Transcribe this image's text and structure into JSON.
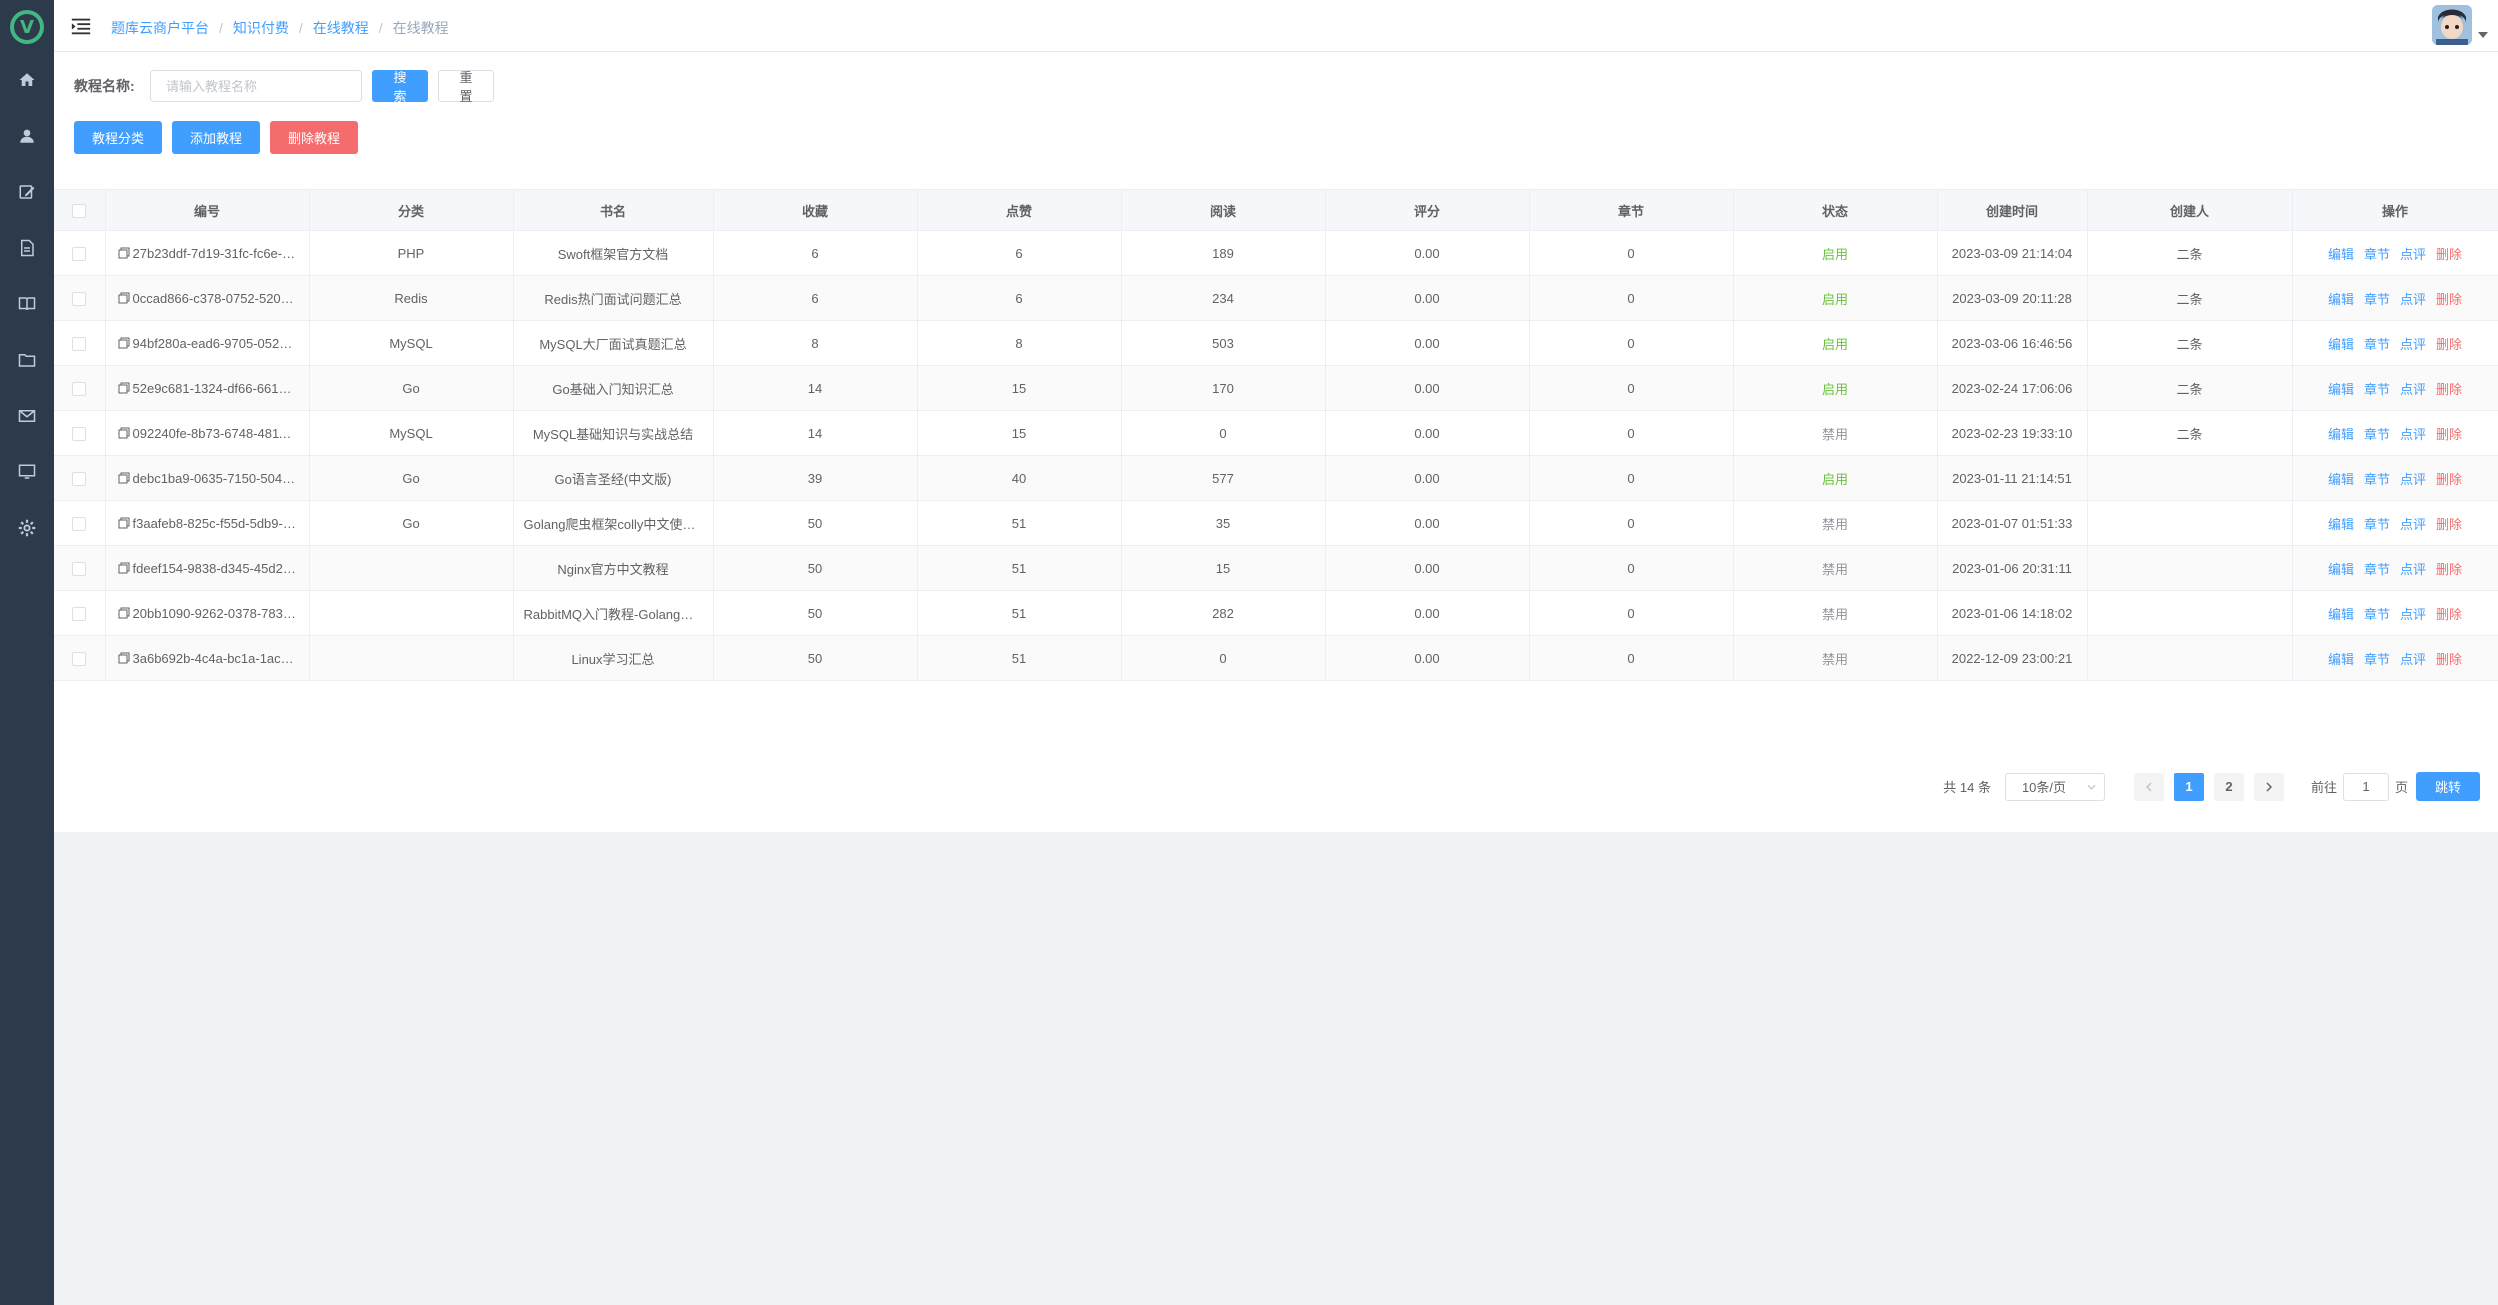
{
  "sidebar": {
    "logo_letter": "V",
    "items": [
      {
        "icon": "home-icon"
      },
      {
        "icon": "user-icon"
      },
      {
        "icon": "edit-icon"
      },
      {
        "icon": "document-icon"
      },
      {
        "icon": "book-icon"
      },
      {
        "icon": "folder-icon"
      },
      {
        "icon": "mail-icon"
      },
      {
        "icon": "monitor-icon"
      },
      {
        "icon": "gear-icon"
      }
    ]
  },
  "header": {
    "breadcrumb": [
      "题库云商户平台",
      "知识付费",
      "在线教程",
      "在线教程"
    ]
  },
  "search": {
    "label": "教程名称:",
    "placeholder": "请输入教程名称",
    "value": "",
    "search_label": "搜索",
    "reset_label": "重置"
  },
  "actions": {
    "category_label": "教程分类",
    "add_label": "添加教程",
    "delete_label": "删除教程"
  },
  "table": {
    "columns": [
      "编号",
      "分类",
      "书名",
      "收藏",
      "点赞",
      "阅读",
      "评分",
      "章节",
      "状态",
      "创建时间",
      "创建人",
      "操作"
    ],
    "ops": [
      "编辑",
      "章节",
      "点评",
      "删除"
    ],
    "rows": [
      {
        "id": "27b23ddf-7d19-31fc-fc6e-0…",
        "category": "PHP",
        "title": "Swoft框架官方文档",
        "fav": "6",
        "likes": "6",
        "reads": "189",
        "score": "0.00",
        "chapters": "0",
        "status": "启用",
        "status_on": true,
        "created": "2023-03-09 21:14:04",
        "creator": "二条"
      },
      {
        "id": "0ccad866-c378-0752-5201-…",
        "category": "Redis",
        "title": "Redis热门面试问题汇总",
        "fav": "6",
        "likes": "6",
        "reads": "234",
        "score": "0.00",
        "chapters": "0",
        "status": "启用",
        "status_on": true,
        "created": "2023-03-09 20:11:28",
        "creator": "二条"
      },
      {
        "id": "94bf280a-ead6-9705-0524-…",
        "category": "MySQL",
        "title": "MySQL大厂面试真题汇总",
        "fav": "8",
        "likes": "8",
        "reads": "503",
        "score": "0.00",
        "chapters": "0",
        "status": "启用",
        "status_on": true,
        "created": "2023-03-06 16:46:56",
        "creator": "二条"
      },
      {
        "id": "52e9c681-1324-df66-6617-…",
        "category": "Go",
        "title": "Go基础入门知识汇总",
        "fav": "14",
        "likes": "15",
        "reads": "170",
        "score": "0.00",
        "chapters": "0",
        "status": "启用",
        "status_on": true,
        "created": "2023-02-24 17:06:06",
        "creator": "二条"
      },
      {
        "id": "092240fe-8b73-6748-4811-…",
        "category": "MySQL",
        "title": "MySQL基础知识与实战总结",
        "fav": "14",
        "likes": "15",
        "reads": "0",
        "score": "0.00",
        "chapters": "0",
        "status": "禁用",
        "status_on": false,
        "created": "2023-02-23 19:33:10",
        "creator": "二条"
      },
      {
        "id": "debc1ba9-0635-7150-504a-…",
        "category": "Go",
        "title": "Go语言圣经(中文版)",
        "fav": "39",
        "likes": "40",
        "reads": "577",
        "score": "0.00",
        "chapters": "0",
        "status": "启用",
        "status_on": true,
        "created": "2023-01-11 21:14:51",
        "creator": ""
      },
      {
        "id": "f3aafeb8-825c-f55d-5db9-d…",
        "category": "Go",
        "title": "Golang爬虫框架colly中文使用…",
        "fav": "50",
        "likes": "51",
        "reads": "35",
        "score": "0.00",
        "chapters": "0",
        "status": "禁用",
        "status_on": false,
        "created": "2023-01-07 01:51:33",
        "creator": ""
      },
      {
        "id": "fdeef154-9838-d345-45d2-6…",
        "category": "",
        "title": "Nginx官方中文教程",
        "fav": "50",
        "likes": "51",
        "reads": "15",
        "score": "0.00",
        "chapters": "0",
        "status": "禁用",
        "status_on": false,
        "created": "2023-01-06 20:31:11",
        "creator": ""
      },
      {
        "id": "20bb1090-9262-0378-783f-…",
        "category": "",
        "title": "RabbitMQ入门教程-Golang中…",
        "fav": "50",
        "likes": "51",
        "reads": "282",
        "score": "0.00",
        "chapters": "0",
        "status": "禁用",
        "status_on": false,
        "created": "2023-01-06 14:18:02",
        "creator": ""
      },
      {
        "id": "3a6b692b-4c4a-bc1a-1ace-…",
        "category": "",
        "title": "Linux学习汇总",
        "fav": "50",
        "likes": "51",
        "reads": "0",
        "score": "0.00",
        "chapters": "0",
        "status": "禁用",
        "status_on": false,
        "created": "2022-12-09 23:00:21",
        "creator": ""
      }
    ]
  },
  "pagination": {
    "total_label": "共 14 条",
    "page_size": "10条/页",
    "pages": [
      "1",
      "2"
    ],
    "current": "1",
    "goto_prefix": "前往",
    "goto_value": "1",
    "goto_suffix": "页",
    "jump_label": "跳转"
  },
  "colors": {
    "sidebar_bg": "#2d3a4b",
    "primary": "#409eff",
    "danger": "#f56c6c",
    "success": "#67c23a"
  }
}
